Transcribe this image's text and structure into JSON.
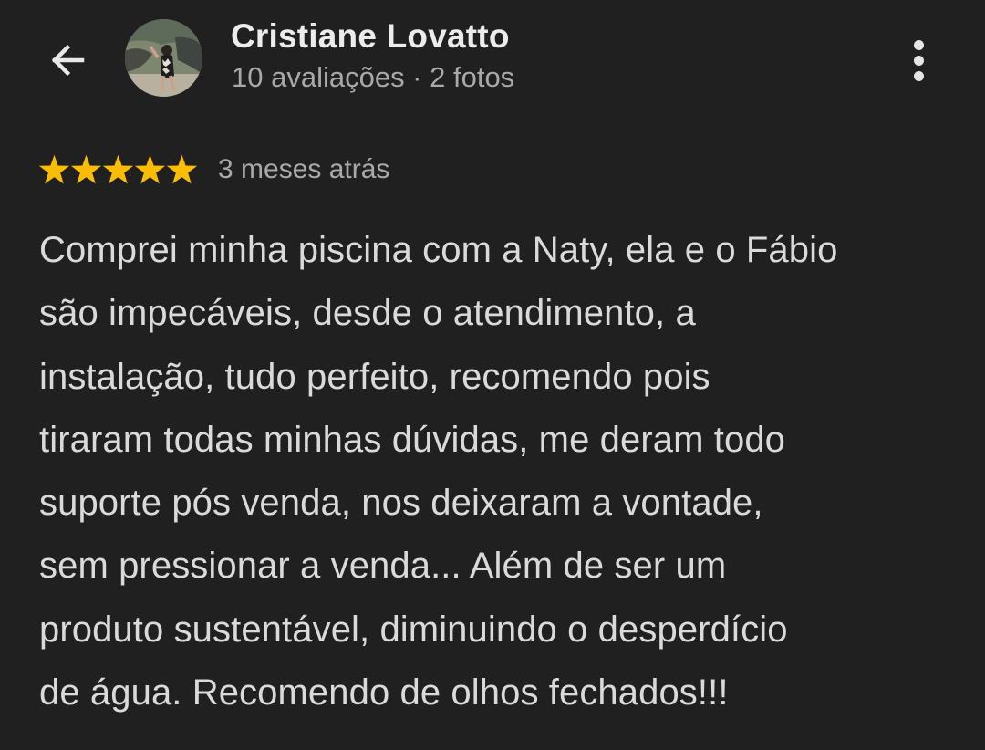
{
  "header": {
    "back_icon": "arrow-left-icon",
    "reviewer_name": "Cristiane Lovatto",
    "reviewer_stats": "10 avaliações · 2 fotos",
    "more_icon": "more-vert-icon"
  },
  "review": {
    "rating": 5,
    "rating_max": 5,
    "star_color": "#fbbc04",
    "date": "3 meses atrás",
    "text_lines": [
      "Comprei minha piscina com a Naty, ela e o Fábio",
      "são impecáveis, desde o atendimento, a",
      "instalação, tudo perfeito, recomendo pois",
      "tiraram todas minhas dúvidas, me deram todo",
      "suporte pós venda, nos deixaram a vontade,",
      "sem pressionar a venda... Além de ser um",
      "produto sustentável, diminuindo o desperdício",
      "de água. Recomendo de olhos fechados!!!"
    ]
  },
  "colors": {
    "background": "#202020",
    "primary_text": "#ececec",
    "secondary_text": "#a9a9a9"
  }
}
